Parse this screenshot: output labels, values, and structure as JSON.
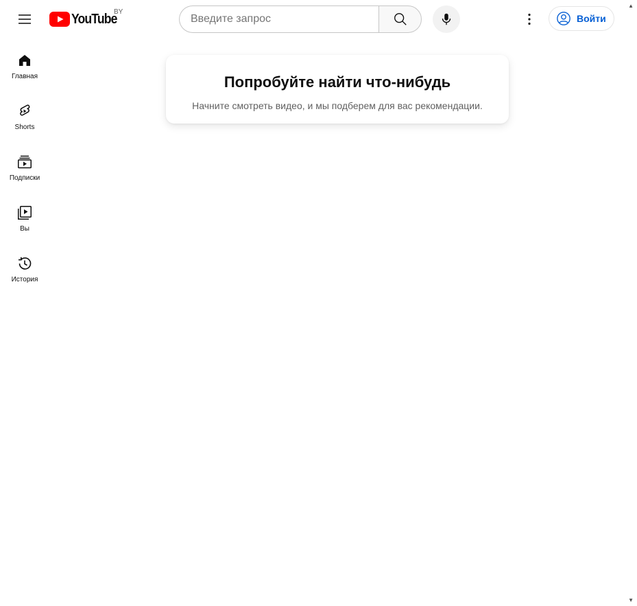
{
  "header": {
    "logo_text": "YouTube",
    "country_code": "BY",
    "search_placeholder": "Введите запрос",
    "signin_label": "Войти",
    "brand_red": "#ff0000",
    "link_blue": "#065fd4"
  },
  "guide": {
    "items": [
      {
        "label": "Главная",
        "icon": "home-icon"
      },
      {
        "label": "Shorts",
        "icon": "shorts-icon"
      },
      {
        "label": "Подписки",
        "icon": "subscriptions-icon"
      },
      {
        "label": "Вы",
        "icon": "you-library-icon"
      },
      {
        "label": "История",
        "icon": "history-icon"
      }
    ]
  },
  "feed_prompt": {
    "title": "Попробуйте найти что-нибудь",
    "subtitle": "Начните смотреть видео, и мы подберем для вас рекомендации."
  }
}
